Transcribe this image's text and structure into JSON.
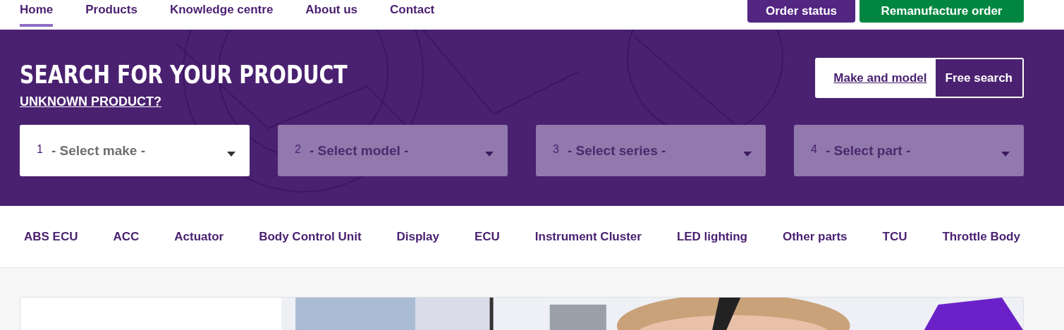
{
  "nav": {
    "items": [
      {
        "label": "Home",
        "selected": true
      },
      {
        "label": "Products",
        "selected": false
      },
      {
        "label": "Knowledge centre",
        "selected": false
      },
      {
        "label": "About us",
        "selected": false
      },
      {
        "label": "Contact",
        "selected": false
      }
    ],
    "buttons": [
      {
        "label": "Order status",
        "kind": "primary"
      },
      {
        "label": "Remanufacture order",
        "kind": "success"
      }
    ]
  },
  "search": {
    "title": "SEARCH FOR YOUR PRODUCT",
    "link": "UNKNOWN PRODUCT?",
    "modes": [
      {
        "label": "Make and model",
        "selected": false
      },
      {
        "label": "Free search",
        "selected": true
      }
    ],
    "selects": [
      {
        "number": "1",
        "placeholder": "- Select make -",
        "disabled": false
      },
      {
        "number": "2",
        "placeholder": "- Select model -",
        "disabled": true
      },
      {
        "number": "3",
        "placeholder": "- Select series -",
        "disabled": true
      },
      {
        "number": "4",
        "placeholder": "- Select part -",
        "disabled": true
      }
    ]
  },
  "categories": [
    "ABS ECU",
    "ACC",
    "Actuator",
    "Body Control Unit",
    "Display",
    "ECU",
    "Instrument Cluster",
    "LED lighting",
    "Other parts",
    "TCU",
    "Throttle Body"
  ]
}
